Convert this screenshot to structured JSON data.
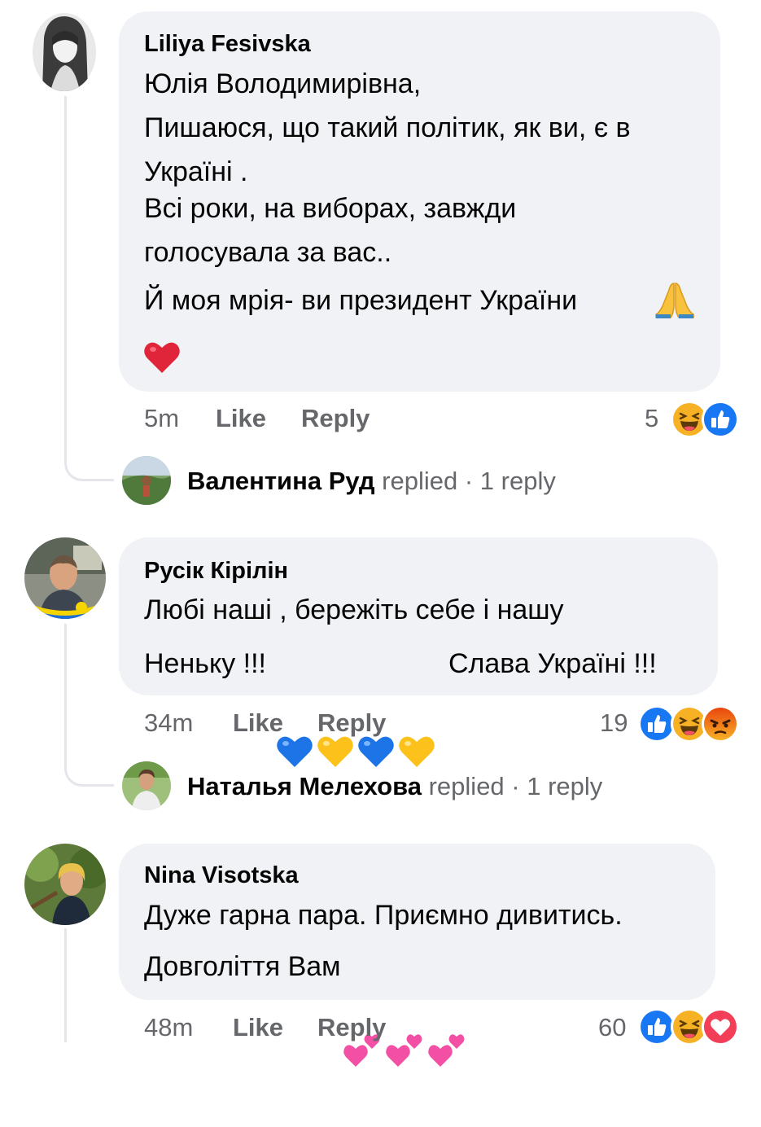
{
  "comments": [
    {
      "author": "Liliya Fesivska",
      "lines": [
        "Юлія Володимирівна,",
        "Пишаюся, що такий політик, як ви, є в",
        "Україні .",
        "Всі роки, на виборах, завжди",
        "голосувала за вас..",
        "Й моя мрія- ви президент України"
      ],
      "emojis": [
        "folded-hands",
        "red-heart"
      ],
      "time": "5m",
      "like": "Like",
      "reply": "Reply",
      "reaction_count": "5",
      "reactions": [
        "haha",
        "like"
      ],
      "replied_by": "Валентина Руд",
      "replied_text": "replied",
      "reply_count": "· 1 reply"
    },
    {
      "author": "Русік Кірілін",
      "line1": "Любі наші , бережіть себе і нашу",
      "line2_start": "Неньку !!!",
      "hearts": [
        "blue",
        "yellow",
        "blue",
        "yellow"
      ],
      "line2_end": "Слава Україні !!!",
      "time": "34m",
      "like": "Like",
      "reply": "Reply",
      "reaction_count": "19",
      "reactions": [
        "like",
        "haha",
        "angry"
      ],
      "replied_by": "Наталья Мелехова",
      "replied_text": "replied",
      "reply_count": "· 1 reply"
    },
    {
      "author": "Nina Visotska",
      "line1": "Дуже гарна пара. Приємно дивитись.",
      "line2": "Довголіття Вам",
      "emojis": [
        "two-hearts",
        "two-hearts",
        "two-hearts"
      ],
      "time": "48m",
      "like": "Like",
      "reply": "Reply",
      "reaction_count": "60",
      "reactions": [
        "like",
        "haha",
        "love"
      ]
    }
  ],
  "colors": {
    "bubble": "#f0f2f5",
    "meta_text": "#65676b",
    "like_blue": "#1877f2",
    "haha_yellow": "#f7b125",
    "angry_red": "#e9710f",
    "love_red": "#f33e58"
  }
}
